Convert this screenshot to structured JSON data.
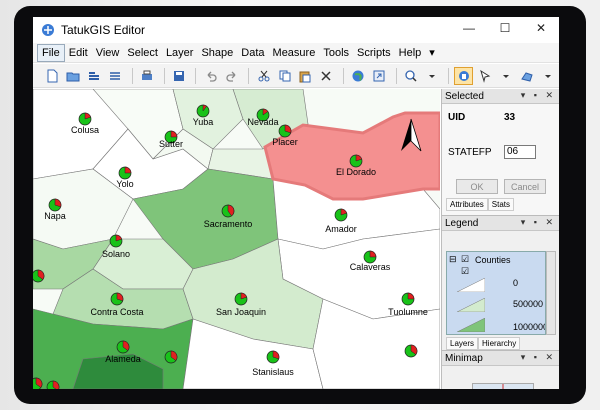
{
  "window": {
    "title": "TatukGIS Editor"
  },
  "menu": [
    "File",
    "Edit",
    "View",
    "Select",
    "Layer",
    "Shape",
    "Data",
    "Measure",
    "Tools",
    "Scripts",
    "Help"
  ],
  "toolbar_icons": [
    "new-file-icon",
    "open-folder-icon",
    "add-layer-icon",
    "list-icon",
    "print-icon",
    "save-icon",
    "undo-icon",
    "redo-icon",
    "cut-icon",
    "copy-icon",
    "paste-icon",
    "delete-icon",
    "globe-icon",
    "export-icon",
    "zoom-icon",
    "hand-icon",
    "select-arrow-icon",
    "shape-icon"
  ],
  "map": {
    "counties": [
      {
        "name": "Colusa"
      },
      {
        "name": "Yuba"
      },
      {
        "name": "Nevada"
      },
      {
        "name": "Sutter"
      },
      {
        "name": "Placer"
      },
      {
        "name": "El Dorado"
      },
      {
        "name": "Yolo"
      },
      {
        "name": "Napa"
      },
      {
        "name": "Sacramento"
      },
      {
        "name": "Amador"
      },
      {
        "name": "Solano"
      },
      {
        "name": "Calaveras"
      },
      {
        "name": "Contra Costa"
      },
      {
        "name": "San Joaquin"
      },
      {
        "name": "Tuolumne"
      },
      {
        "name": "Alameda"
      },
      {
        "name": "Stanislaus"
      }
    ]
  },
  "selected": {
    "title": "Selected",
    "fields": [
      {
        "label": "UID",
        "value": "33"
      },
      {
        "label": "STATEFP",
        "value": "06"
      }
    ],
    "ok": "OK",
    "cancel": "Cancel",
    "tabs": [
      "Attributes",
      "Stats"
    ]
  },
  "legend": {
    "title": "Legend",
    "layer": "Counties",
    "classes": [
      "0",
      "500000",
      "1000000"
    ],
    "tabs": [
      "Layers",
      "Hierarchy"
    ]
  },
  "minimap": {
    "title": "Minimap"
  }
}
